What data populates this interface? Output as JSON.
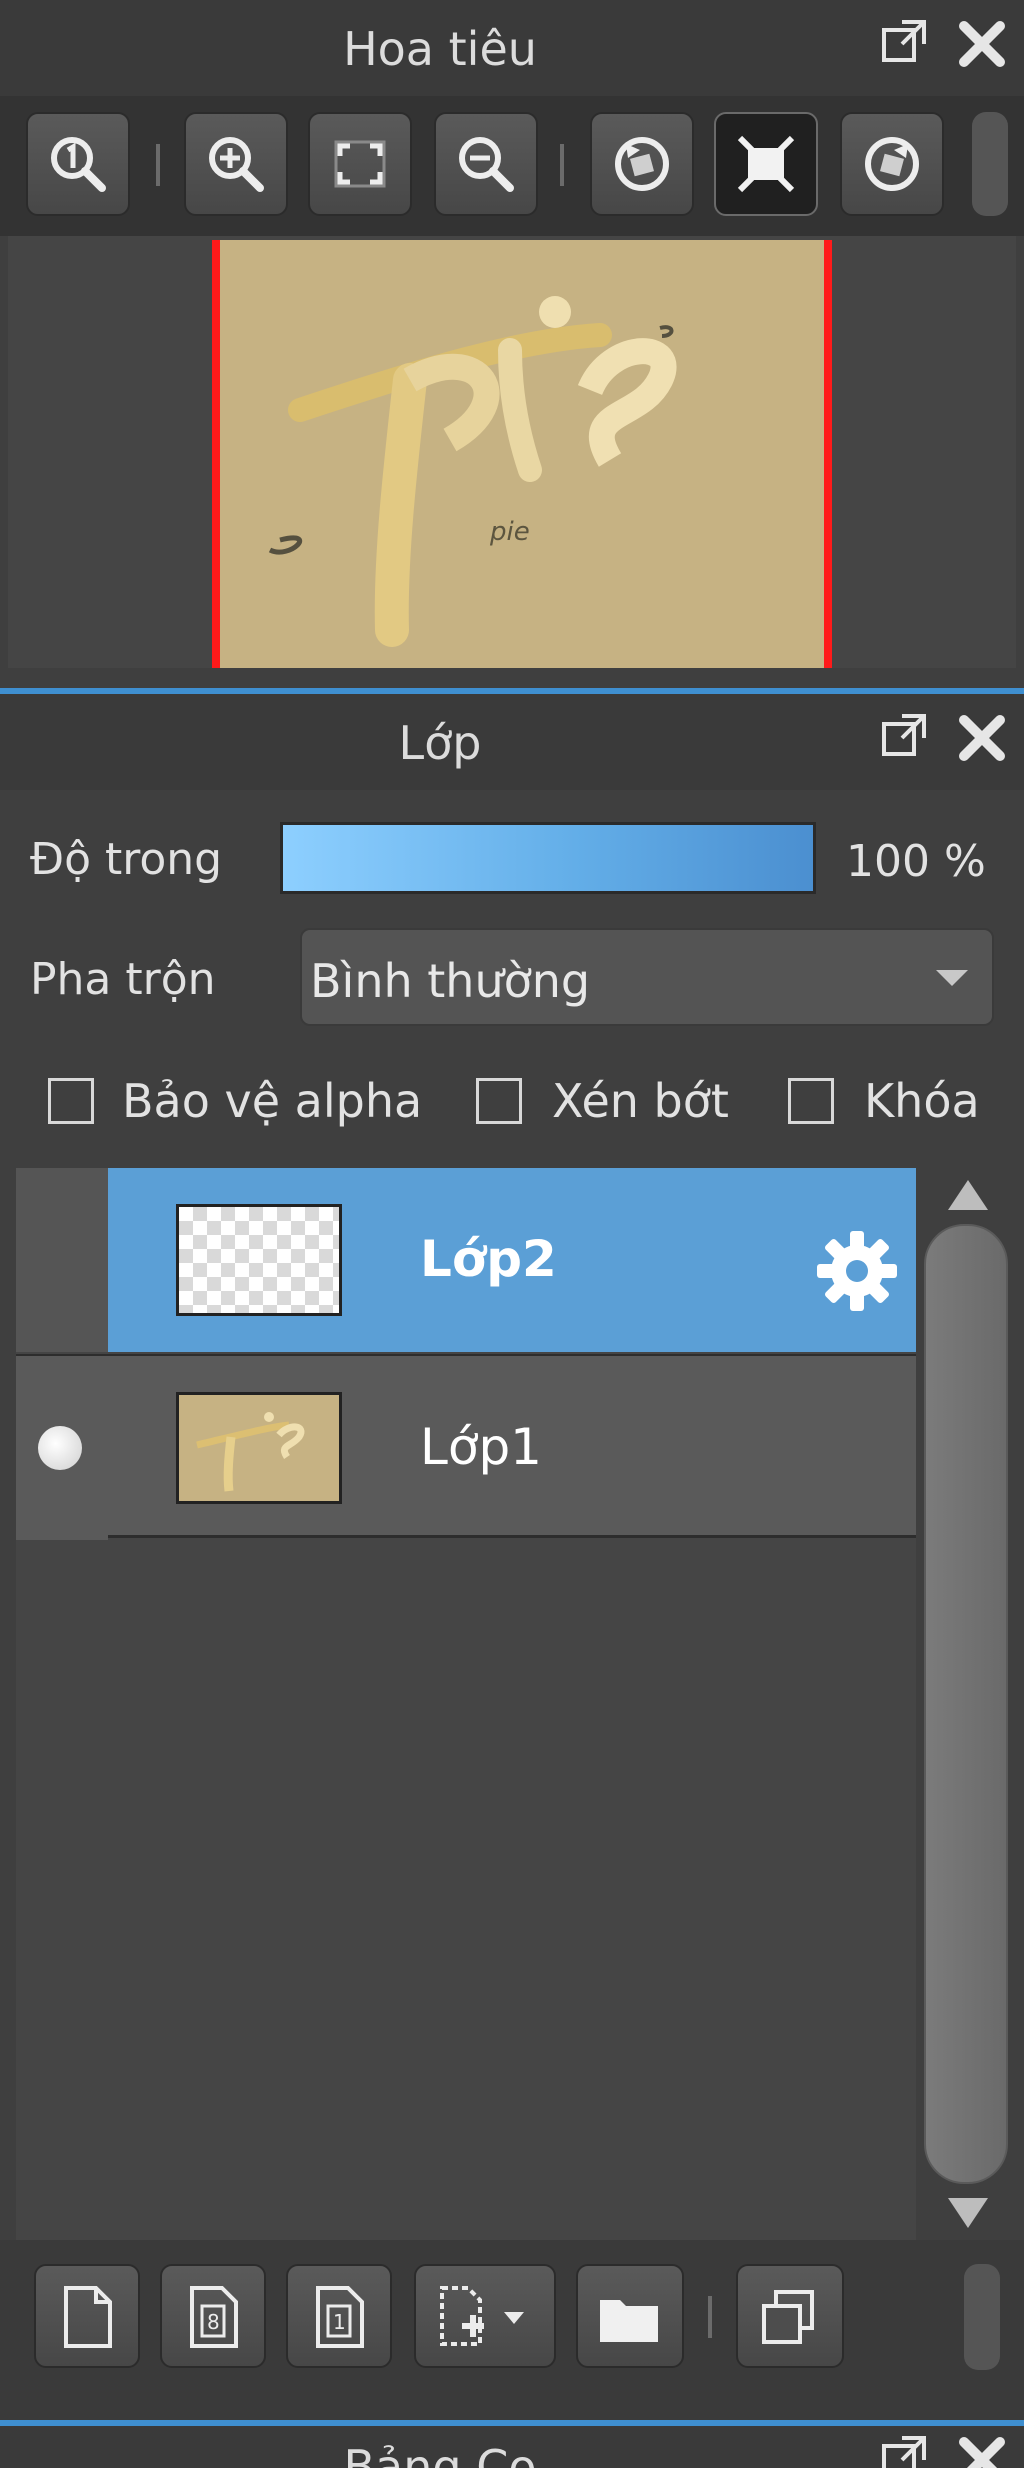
{
  "navigator": {
    "title": "Hoa tiêu",
    "icons": [
      "zoom-actual-icon",
      "zoom-in-icon",
      "fit-screen-icon",
      "zoom-out-icon",
      "rotate-left-icon",
      "fullscreen-icon",
      "rotate-right-icon"
    ]
  },
  "layer_panel": {
    "title": "Lớp",
    "opacity_label": "Độ trong",
    "opacity_value": "100 %",
    "opacity_fraction": 1.0,
    "blend_label": "Pha trộn",
    "blend_value": "Bình thường",
    "checkboxes": [
      {
        "label": "Bảo vệ alpha",
        "checked": false
      },
      {
        "label": "Xén bớt",
        "checked": false
      },
      {
        "label": "Khóa",
        "checked": false
      }
    ],
    "layers": [
      {
        "name": "Lớp2",
        "selected": true,
        "visible": false
      },
      {
        "name": "Lớp1",
        "selected": false,
        "visible": true
      }
    ],
    "bottom_icons": [
      "new-layer-icon",
      "new-8bit-layer-icon",
      "new-1bit-layer-icon",
      "add-layer-menu-icon",
      "new-folder-icon",
      "duplicate-layer-icon"
    ]
  },
  "bottom_panel": {
    "title": "Bảng Cọ"
  },
  "colors": {
    "accent": "#5b9fd6",
    "panel_bg": "#3f3f3f",
    "canvas": "#c6b283",
    "frame": "#ff1a1a"
  }
}
